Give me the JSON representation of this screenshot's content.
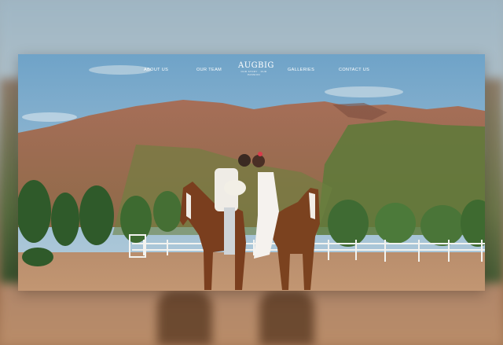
{
  "nav": {
    "items": [
      {
        "label": "ABOUT US"
      },
      {
        "label": "OUR TEAM"
      },
      {
        "label": "GALLERIES"
      },
      {
        "label": "CONTACT US"
      }
    ],
    "logo_main": "AUGBIG",
    "logo_sub": "OUR STORY · OUR PASSION"
  },
  "colors": {
    "sky": "#79aacb",
    "hills": "#a4705a",
    "ground": "#b88d6c",
    "fence": "#f3f3f0",
    "horse": "#7a3e1e"
  }
}
